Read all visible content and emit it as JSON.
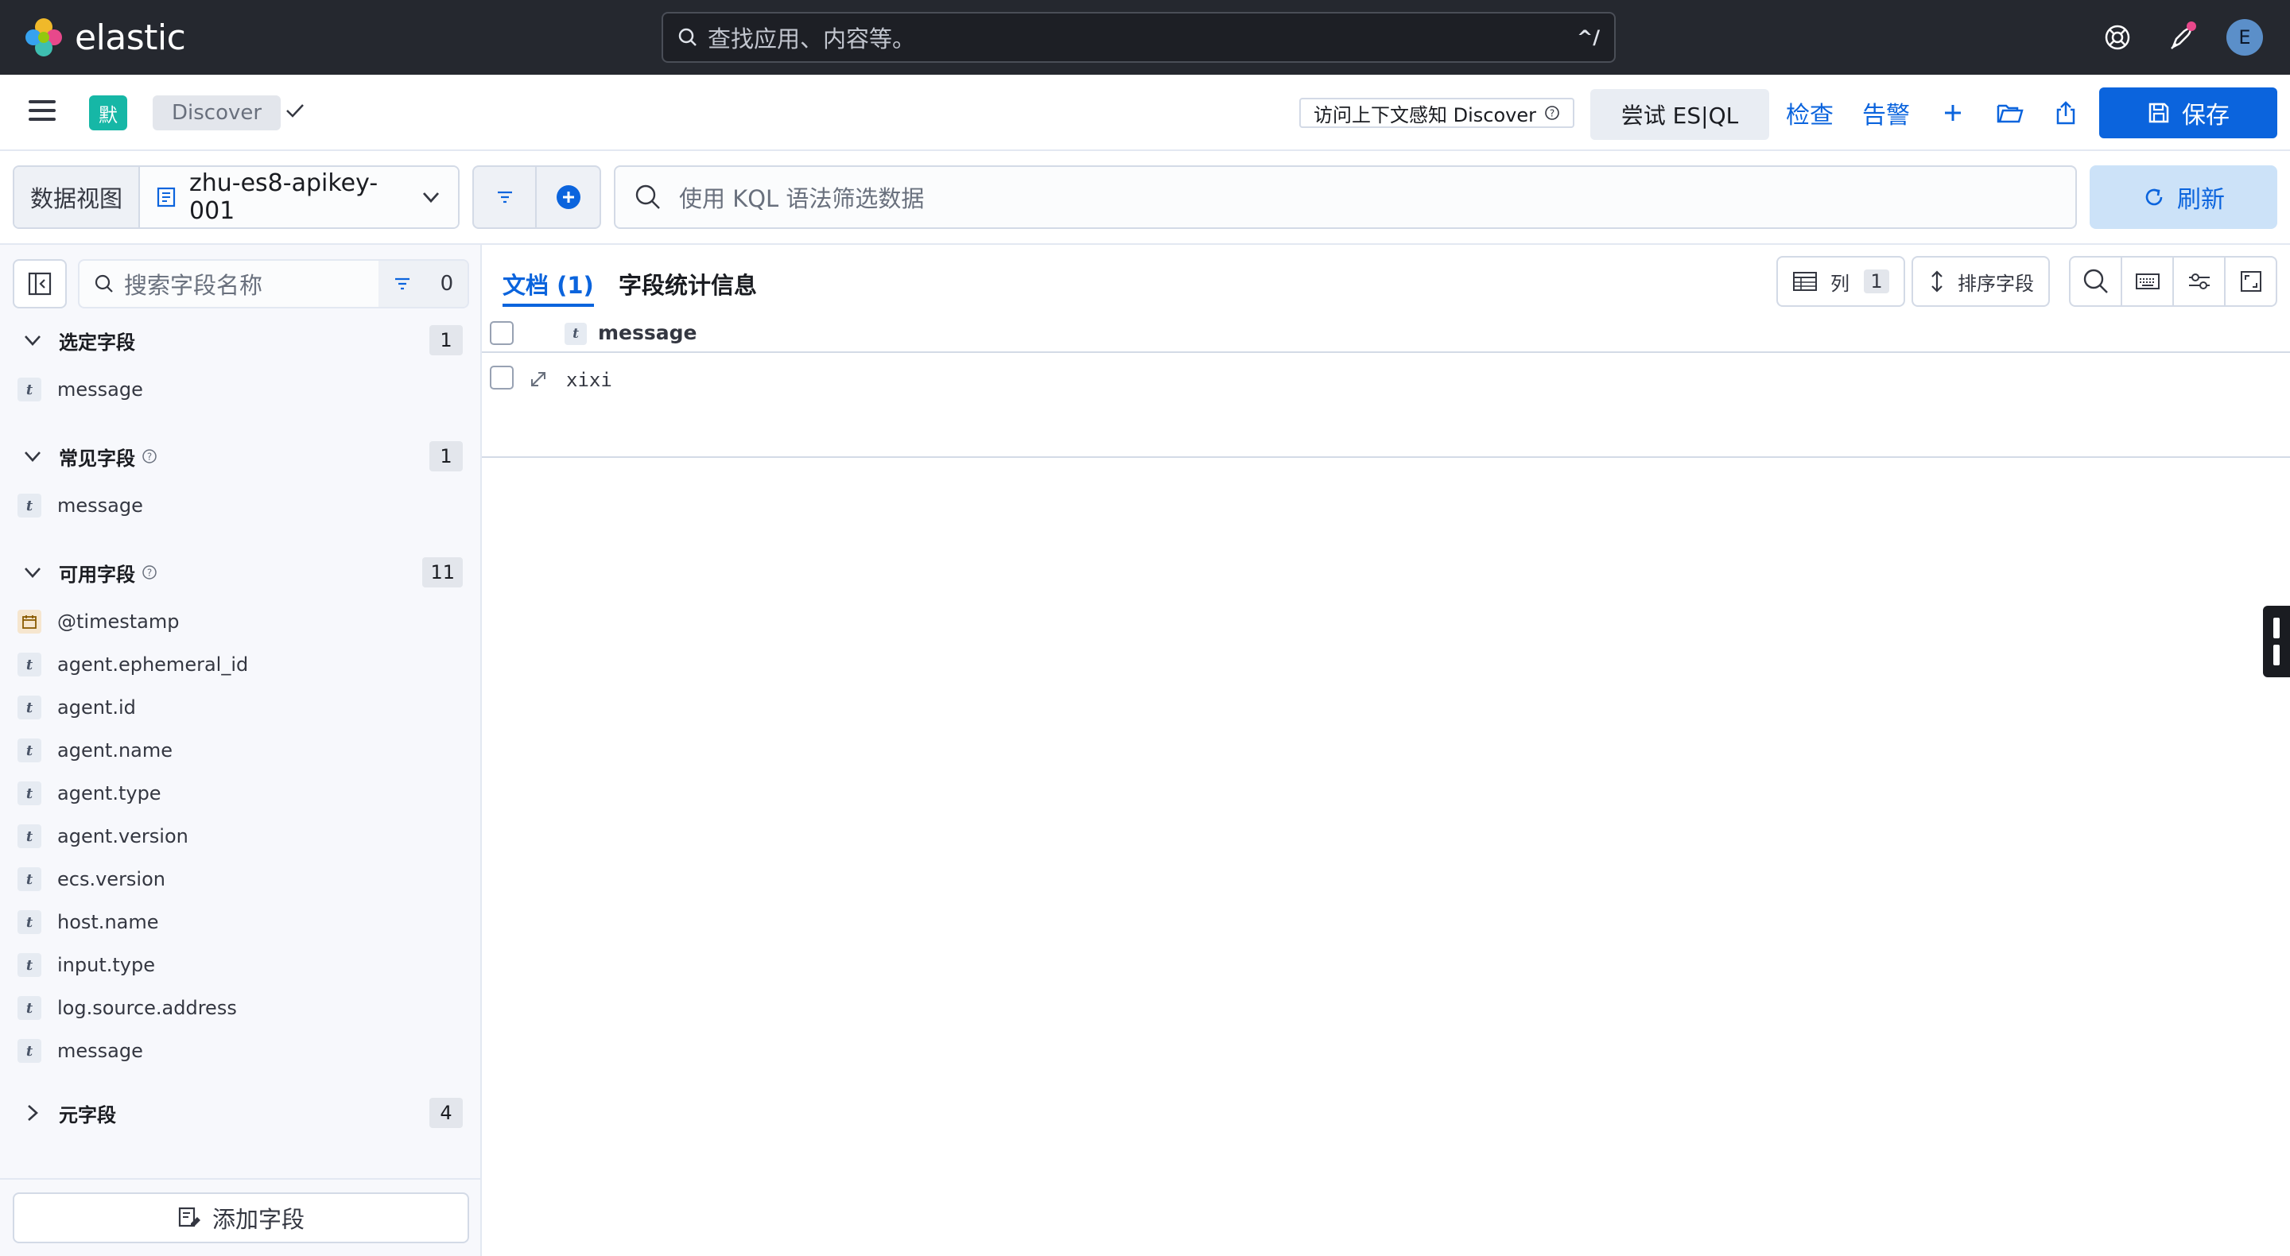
{
  "topbar": {
    "brand": "elastic",
    "search_placeholder": "查找应用、内容等。",
    "search_shortcut": "^/",
    "avatar_initial": "E"
  },
  "app_header": {
    "space_badge": "默",
    "breadcrumb": "Discover",
    "context_button": "访问上下文感知 Discover",
    "esql_button": "尝试 ES|QL",
    "inspect_link": "检查",
    "alerts_link": "告警",
    "save_button": "保存"
  },
  "query_bar": {
    "data_view_label": "数据视图",
    "data_view_name": "zhu-es8-apikey-001",
    "kql_placeholder": "使用 KQL 语法筛选数据",
    "refresh_button": "刷新"
  },
  "sidebar": {
    "search_placeholder": "搜索字段名称",
    "filter_count": "0",
    "sections": {
      "selected": {
        "title": "选定字段",
        "count": "1",
        "fields": [
          "message"
        ]
      },
      "popular": {
        "title": "常见字段",
        "count": "1",
        "fields": [
          "message"
        ]
      },
      "available": {
        "title": "可用字段",
        "count": "11",
        "fields": [
          "@timestamp",
          "agent.ephemeral_id",
          "agent.id",
          "agent.name",
          "agent.type",
          "agent.version",
          "ecs.version",
          "host.name",
          "input.type",
          "log.source.address",
          "message"
        ]
      },
      "meta": {
        "title": "元字段",
        "count": "4"
      }
    },
    "add_field_button": "添加字段"
  },
  "main": {
    "tabs": {
      "documents": "文档 (1)",
      "field_stats": "字段统计信息"
    },
    "columns_button": "列",
    "columns_count": "1",
    "sort_button": "排序字段",
    "grid": {
      "column_header": "message",
      "rows": [
        {
          "message": "xixi"
        }
      ]
    }
  },
  "colors": {
    "accent": "#0b64dd",
    "topbar_bg": "#25282f",
    "space_badge": "#16b7a6"
  }
}
